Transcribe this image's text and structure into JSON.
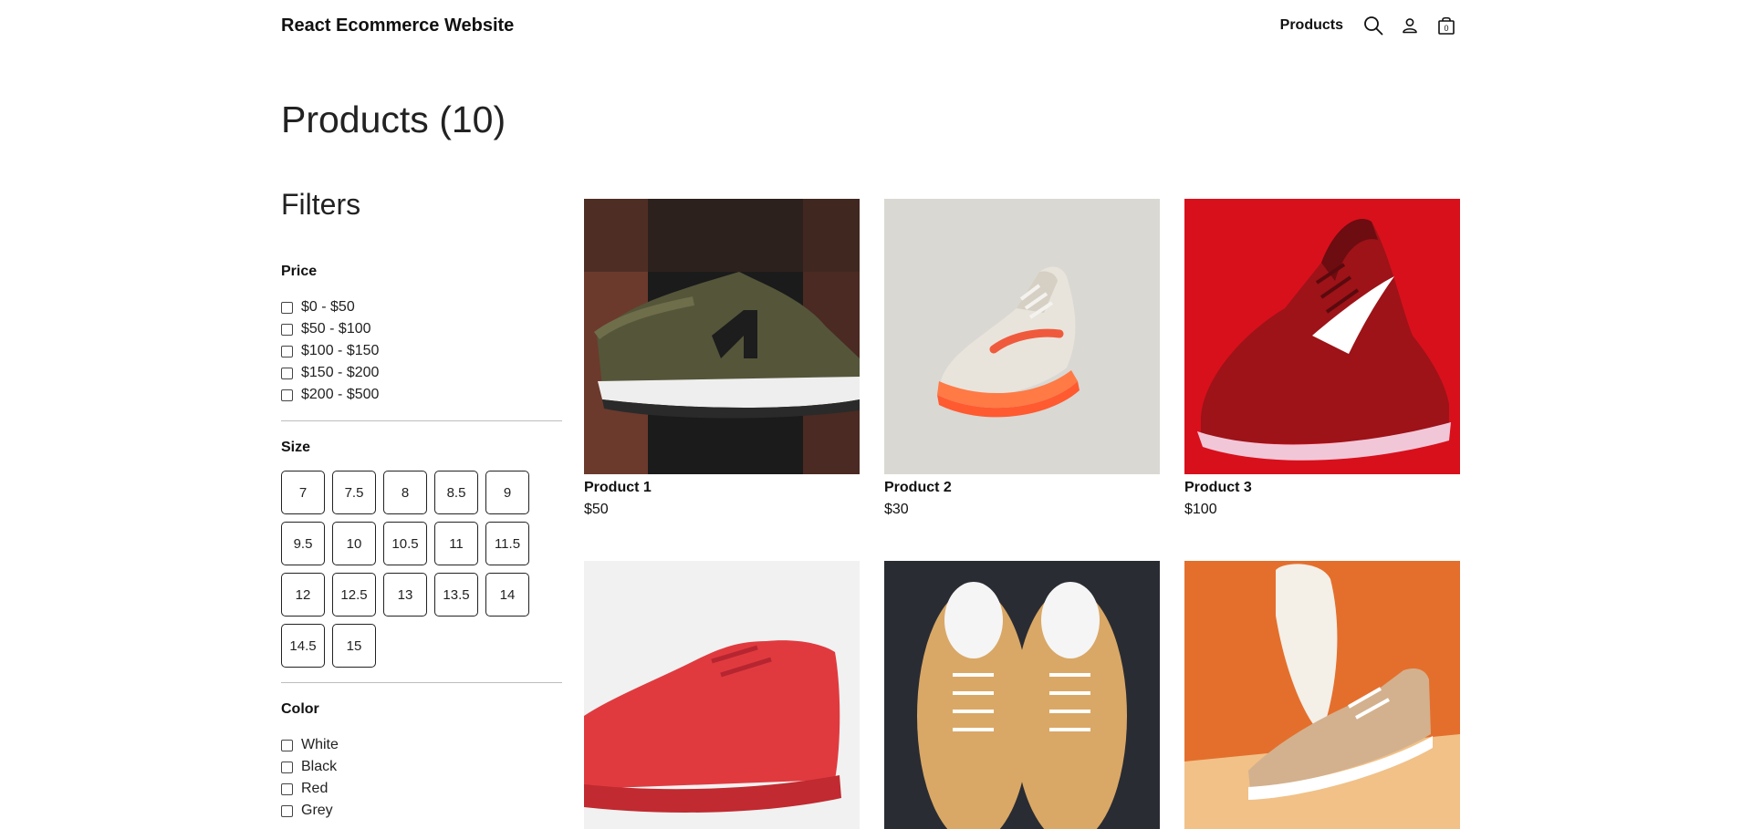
{
  "header": {
    "brand": "React Ecommerce Website",
    "nav_link": "Products",
    "icons": [
      "search-icon",
      "user-icon",
      "bag-icon"
    ],
    "cart_count": "0"
  },
  "page": {
    "title": "Products (10)"
  },
  "filters": {
    "title": "Filters",
    "price": {
      "label": "Price",
      "options": [
        "$0 - $50",
        "$50 - $100",
        "$100 - $150",
        "$150 - $200",
        "$200 - $500"
      ]
    },
    "size": {
      "label": "Size",
      "options": [
        "7",
        "7.5",
        "8",
        "8.5",
        "9",
        "9.5",
        "10",
        "10.5",
        "11",
        "11.5",
        "12",
        "12.5",
        "13",
        "13.5",
        "14",
        "14.5",
        "15"
      ]
    },
    "color": {
      "label": "Color",
      "options": [
        "White",
        "Black",
        "Red",
        "Grey"
      ]
    }
  },
  "products": [
    {
      "name": "Product 1",
      "price": "$50",
      "image": "olive-new-balance-sneaker"
    },
    {
      "name": "Product 2",
      "price": "$30",
      "image": "white-orange-nike-sneaker"
    },
    {
      "name": "Product 3",
      "price": "$100",
      "image": "red-nike-running-shoe"
    },
    {
      "name": "",
      "price": "",
      "image": "red-high-top-sneaker"
    },
    {
      "name": "",
      "price": "",
      "image": "tan-vans-pair"
    },
    {
      "name": "",
      "price": "",
      "image": "white-tan-sneaker-orange-bg"
    }
  ],
  "colors": {
    "text": "#111111",
    "border": "#222222",
    "divider": "#bdbdbd"
  }
}
